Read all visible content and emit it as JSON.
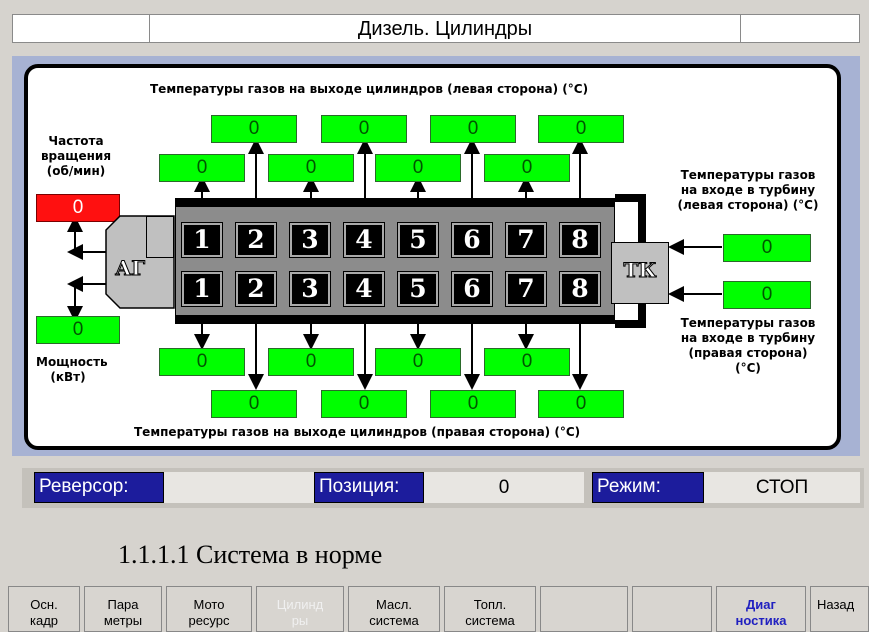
{
  "header": {
    "title": "Дизель. Цилиндры"
  },
  "labels": {
    "left_top": "Температуры газов на выходе цилиндров (левая сторона) (°С)",
    "right_bottom": "Температуры газов на выходе цилиндров (правая сторона) (°С)",
    "rpm": [
      "Частота",
      "вращения",
      "(об/мин)"
    ],
    "power": [
      "Мощность",
      "(кВт)"
    ],
    "turbine_left": [
      "Температуры газов",
      "на входе в турбину",
      "(левая сторона) (°С)"
    ],
    "turbine_right": [
      "Температуры газов",
      "на входе в турбину",
      "(правая сторона)",
      "(°С)"
    ],
    "ag": "АГ",
    "tk": "ТК"
  },
  "values": {
    "rpm": "0",
    "power": "0",
    "left_outer": [
      "0",
      "0",
      "0",
      "0"
    ],
    "left_inner": [
      "0",
      "0",
      "0",
      "0"
    ],
    "right_inner": [
      "0",
      "0",
      "0",
      "0"
    ],
    "right_outer": [
      "0",
      "0",
      "0",
      "0"
    ],
    "turbine_left": "0",
    "turbine_right": "0"
  },
  "cylinders": {
    "top": [
      "1",
      "2",
      "3",
      "4",
      "5",
      "6",
      "7",
      "8"
    ],
    "bottom": [
      "1",
      "2",
      "3",
      "4",
      "5",
      "6",
      "7",
      "8"
    ]
  },
  "status": {
    "reversor_label": "Реверсор:",
    "reversor_value": "",
    "position_label": "Позиция:",
    "position_value": "0",
    "mode_label": "Режим:",
    "mode_value": "СТОП"
  },
  "note": "1.1.1.1 Система в норме",
  "buttons": [
    [
      "Осн.",
      "кадр"
    ],
    [
      "Пара",
      "метры"
    ],
    [
      "Мото",
      "ресурс"
    ],
    [
      "Цилинд",
      "ры"
    ],
    [
      "Масл.",
      "система"
    ],
    [
      "Топл.",
      "система"
    ],
    [
      "",
      ""
    ],
    [
      "",
      ""
    ],
    [
      "Диаг",
      "ностика"
    ],
    [
      "Назад",
      ""
    ]
  ],
  "colors": {
    "ok": "#00ff00",
    "alarm": "#ff1010",
    "status_label_bg": "#1c1c9c",
    "panel_bg": "#a7b2d3"
  }
}
